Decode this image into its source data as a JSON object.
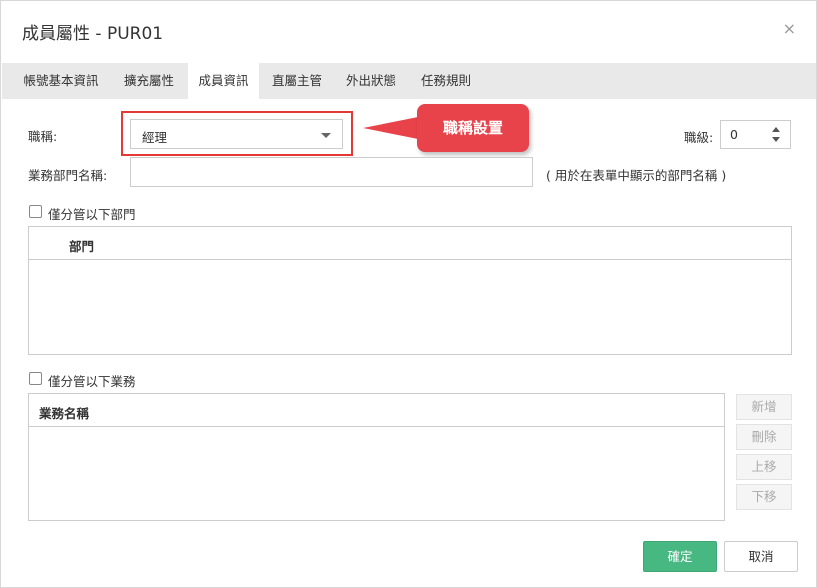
{
  "dialog": {
    "title": "成員屬性 - PUR01",
    "close_glyph": "×"
  },
  "tabs": [
    {
      "label": "帳號基本資訊",
      "active": false
    },
    {
      "label": "擴充屬性",
      "active": false
    },
    {
      "label": "成員資訊",
      "active": true
    },
    {
      "label": "直屬主管",
      "active": false
    },
    {
      "label": "外出狀態",
      "active": false
    },
    {
      "label": "任務規則",
      "active": false
    }
  ],
  "form": {
    "title_label": "職稱:",
    "title_value": "經理",
    "grade_label": "職級:",
    "grade_value": "0",
    "dept_name_label": "業務部門名稱:",
    "dept_name_value": "",
    "dept_name_hint": "( 用於在表單中顯示的部門名稱 )"
  },
  "callout": {
    "text": "職稱設置",
    "color": "#e8434a"
  },
  "dept_section": {
    "checkbox_label": "僅分管以下部門",
    "checked": false,
    "column_header": "部門"
  },
  "biz_section": {
    "checkbox_label": "僅分管以下業務",
    "checked": false,
    "column_header": "業務名稱",
    "buttons": {
      "add": "新增",
      "delete": "刪除",
      "move_up": "上移",
      "move_down": "下移"
    }
  },
  "footer": {
    "ok_label": "確定",
    "cancel_label": "取消",
    "ok_color": "#48b883"
  }
}
